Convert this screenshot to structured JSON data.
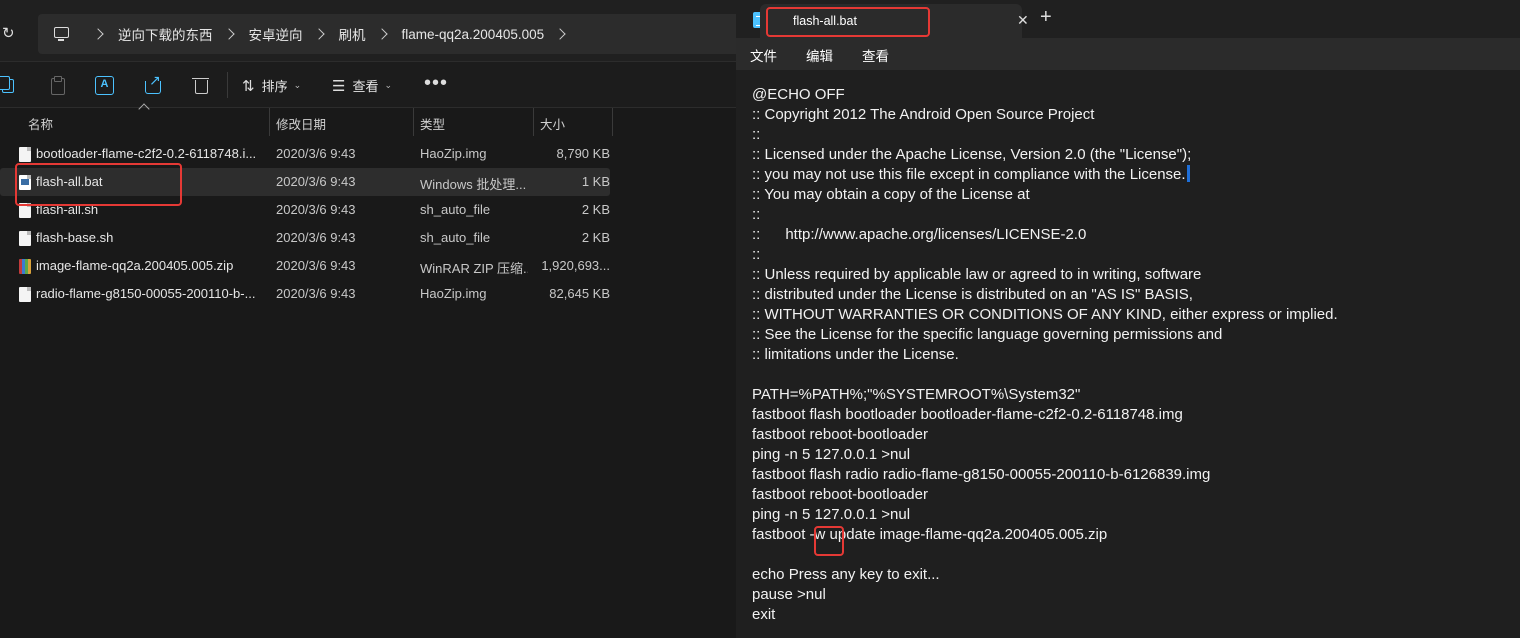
{
  "explorer": {
    "breadcrumb": [
      "逆向下载的东西",
      "安卓逆向",
      "刷机",
      "flame-qq2a.200405.005"
    ],
    "toolbar": {
      "sort_label": "排序",
      "view_label": "查看",
      "more_label": "•••"
    },
    "columns": {
      "name": "名称",
      "date": "修改日期",
      "type": "类型",
      "size": "大小"
    },
    "files": [
      {
        "name": "bootloader-flame-c2f2-0.2-6118748.i...",
        "date": "2020/3/6 9:43",
        "type": "HaoZip.img",
        "size": "8,790 KB",
        "icon": "file-icon"
      },
      {
        "name": "flash-all.bat",
        "date": "2020/3/6 9:43",
        "type": "Windows 批处理...",
        "size": "1 KB",
        "icon": "bat-file-icon"
      },
      {
        "name": "flash-all.sh",
        "date": "2020/3/6 9:43",
        "type": "sh_auto_file",
        "size": "2 KB",
        "icon": "file-icon"
      },
      {
        "name": "flash-base.sh",
        "date": "2020/3/6 9:43",
        "type": "sh_auto_file",
        "size": "2 KB",
        "icon": "file-icon"
      },
      {
        "name": "image-flame-qq2a.200405.005.zip",
        "date": "2020/3/6 9:43",
        "type": "WinRAR ZIP 压缩...",
        "size": "1,920,693...",
        "icon": "zip-archive-icon"
      },
      {
        "name": "radio-flame-g8150-00055-200110-b-...",
        "date": "2020/3/6 9:43",
        "type": "HaoZip.img",
        "size": "82,645 KB",
        "icon": "file-icon"
      }
    ]
  },
  "notepad": {
    "tab_title": "flash-all.bat",
    "menu": [
      "文件",
      "编辑",
      "查看"
    ],
    "lines": [
      "@ECHO OFF",
      ":: Copyright 2012 The Android Open Source Project",
      "::",
      ":: Licensed under the Apache License, Version 2.0 (the \"License\");",
      ":: you may not use this file except in compliance with the License.",
      ":: You may obtain a copy of the License at",
      "::",
      "::      http://www.apache.org/licenses/LICENSE-2.0",
      "::",
      ":: Unless required by applicable law or agreed to in writing, software",
      ":: distributed under the License is distributed on an \"AS IS\" BASIS,",
      ":: WITHOUT WARRANTIES OR CONDITIONS OF ANY KIND, either express or implied.",
      ":: See the License for the specific language governing permissions and",
      ":: limitations under the License.",
      "",
      "PATH=%PATH%;\"%SYSTEMROOT%\\System32\"",
      "fastboot flash bootloader bootloader-flame-c2f2-0.2-6118748.img",
      "fastboot reboot-bootloader",
      "ping -n 5 127.0.0.1 >nul",
      "fastboot flash radio radio-flame-g8150-00055-200110-b-6126839.img",
      "fastboot reboot-bootloader",
      "ping -n 5 127.0.0.1 >nul",
      "fastboot -w update image-flame-qq2a.200405.005.zip",
      "",
      "echo Press any key to exit...",
      "pause >nul",
      "exit"
    ]
  },
  "colors": {
    "highlight": "#e53935",
    "accent": "#4cc2ff",
    "caret": "#1e6fd9"
  }
}
